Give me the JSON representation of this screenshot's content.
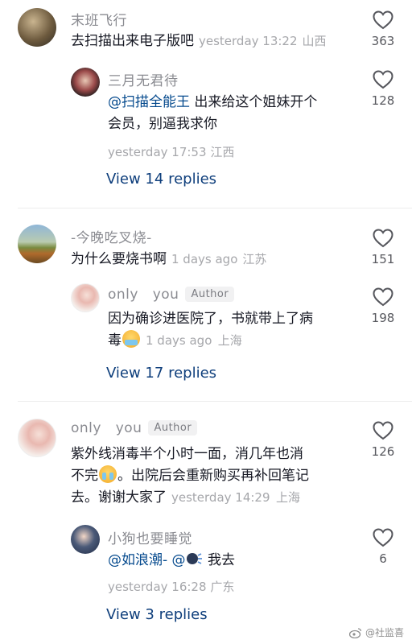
{
  "comments": [
    {
      "username": "末班飞行",
      "text": "去扫描出来电子版吧",
      "time": "yesterday 13:22",
      "location": "山西",
      "likes": "363",
      "reply": {
        "username": "三月无君待",
        "mention": "@扫描全能王",
        "text_line1": " 出来给这个姐妹开个",
        "text_line2": "会员，别逼我求你",
        "time": "yesterday 17:53",
        "location": "江西",
        "likes": "128"
      },
      "view_replies": "View 14 replies"
    },
    {
      "username": "-今晚吃叉烧-",
      "text": "为什么要烧书啊",
      "time": "1 days ago",
      "location": "江苏",
      "likes": "151",
      "reply": {
        "username_part1": "only",
        "username_part2": "you",
        "badge": "Author",
        "text_line1": "因为确诊进医院了，书就带上了病",
        "text_line2": "毒",
        "time": "1 days ago",
        "location": "上海",
        "likes": "198"
      },
      "view_replies": "View 17 replies"
    },
    {
      "username_part1": "only",
      "username_part2": "you",
      "badge": "Author",
      "text_line1": "紫外线消毒半个小时一面，消几年也消",
      "text_line2a": "不完",
      "text_line2b": "。出院后会重新购买再补回笔记",
      "text_line3": "去。谢谢大家了",
      "time": "yesterday 14:29",
      "location": "上海",
      "likes": "126",
      "reply": {
        "username": "小狗也要睡觉",
        "mention1": "@如浪潮-",
        "mention2": "@",
        "text": " 我去",
        "time": "yesterday 16:28",
        "location": "广东",
        "likes": "6"
      },
      "view_replies": "View 3 replies"
    }
  ],
  "watermark": "@社监喜"
}
